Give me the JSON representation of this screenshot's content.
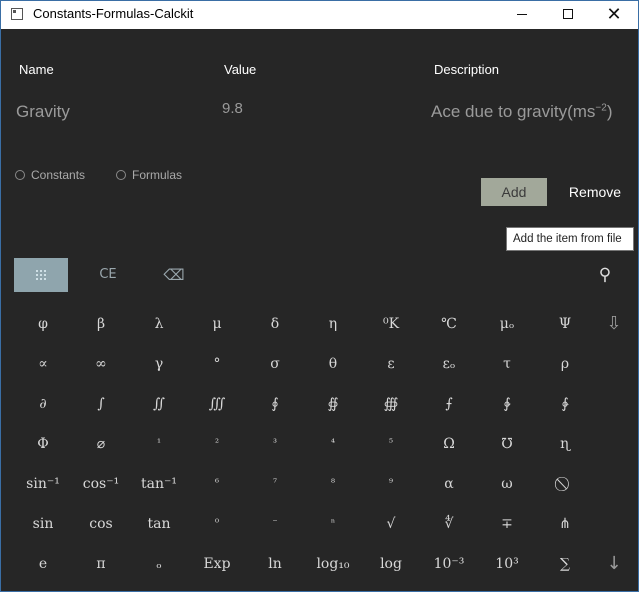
{
  "window": {
    "title": "Constants-Formulas-Calckit"
  },
  "headers": {
    "name": "Name",
    "value": "Value",
    "description": "Description"
  },
  "entry": {
    "name": "Gravity",
    "value": "9.8",
    "description": "Ace due to gravity(ms",
    "description_exp": "−2",
    "description_close": ")"
  },
  "radios": [
    {
      "label": "Constants",
      "selected": false
    },
    {
      "label": "Formulas",
      "selected": false
    }
  ],
  "actions": {
    "add": "Add",
    "remove": "Remove",
    "tooltip": "Add the item from file"
  },
  "toolbar": {
    "clear_entry": "CE",
    "backspace": "⌫",
    "search": "⚲"
  },
  "keypad": [
    [
      "φ",
      "β",
      "λ",
      "μ",
      "δ",
      "η",
      "⁰K",
      "℃",
      "μₒ",
      "Ψ",
      "⇩"
    ],
    [
      "∝",
      "∞",
      "γ",
      "°",
      "σ",
      "θ",
      "ε",
      "εₒ",
      "τ",
      "ρ",
      ""
    ],
    [
      "∂",
      "∫",
      "∬",
      "∭",
      "∮",
      "∯",
      "∰",
      "⨍",
      "∲",
      "∳",
      ""
    ],
    [
      "Φ",
      "⌀",
      "¹",
      "²",
      "³",
      "⁴",
      "⁵",
      "Ω",
      "℧",
      "ɳ",
      ""
    ],
    [
      "sin⁻¹",
      "cos⁻¹",
      "tan⁻¹",
      "⁶",
      "⁷",
      "⁸",
      "⁹",
      "α",
      "ω",
      "⃠",
      ""
    ],
    [
      "sin",
      "cos",
      "tan",
      "⁰",
      "⁻",
      "ⁿ",
      "√",
      "∜",
      "∓",
      "⋔",
      ""
    ],
    [
      "e",
      "π",
      "ₒ",
      "Exp",
      "ln",
      "log₁₀",
      "log",
      "10⁻³",
      "10³",
      "∑",
      "↓"
    ]
  ]
}
